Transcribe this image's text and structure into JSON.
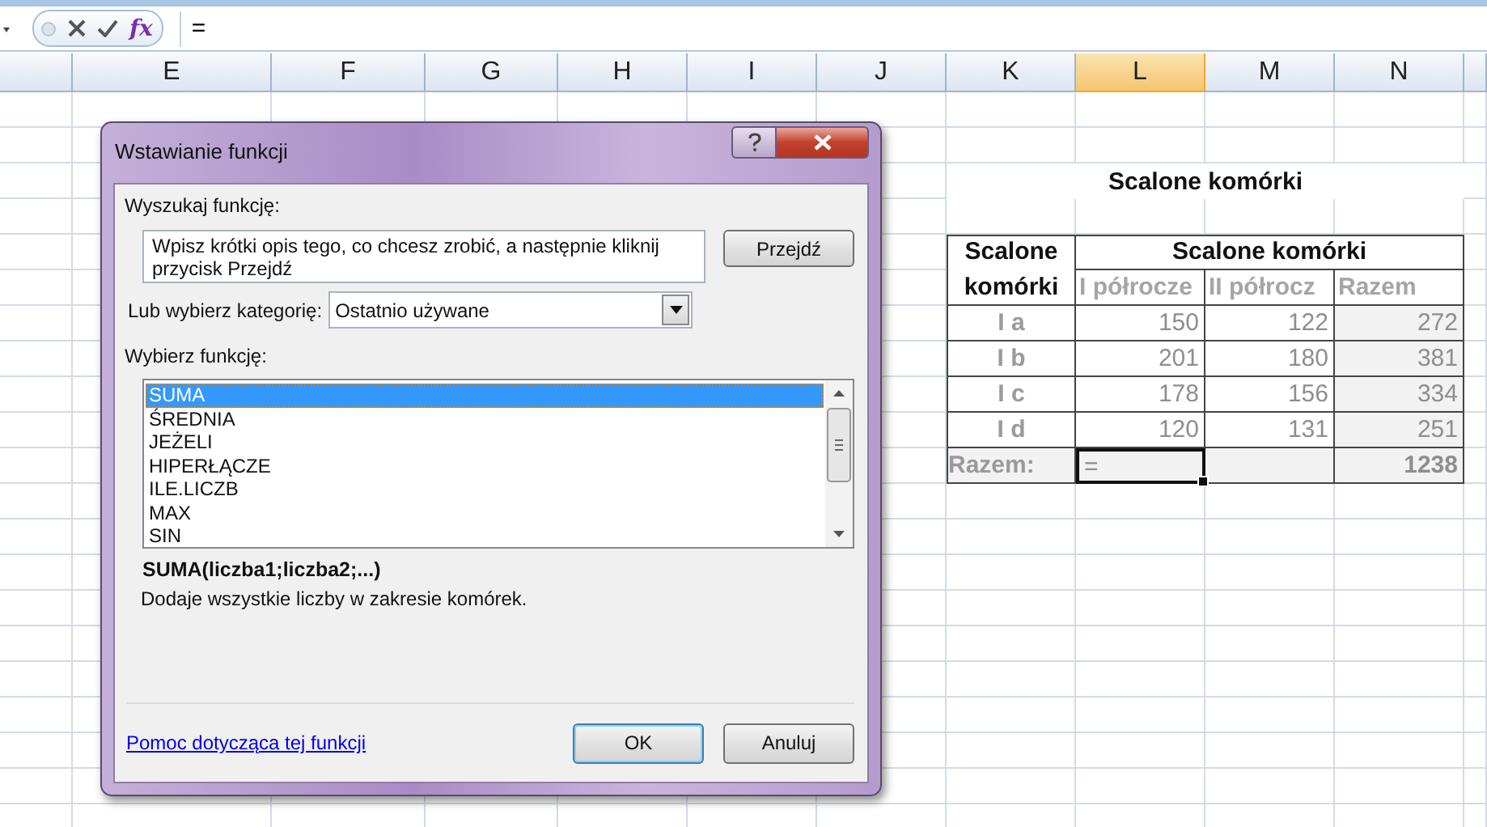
{
  "formula_bar": {
    "function_button": "fx",
    "formula": "="
  },
  "columns": [
    {
      "label": "E",
      "selected": false
    },
    {
      "label": "F",
      "selected": false
    },
    {
      "label": "G",
      "selected": false
    },
    {
      "label": "H",
      "selected": false
    },
    {
      "label": "I",
      "selected": false
    },
    {
      "label": "J",
      "selected": false
    },
    {
      "label": "K",
      "selected": false
    },
    {
      "label": "L",
      "selected": true
    },
    {
      "label": "M",
      "selected": false
    },
    {
      "label": "N",
      "selected": false
    }
  ],
  "sheet": {
    "title": "Scalone komórki",
    "table": {
      "corner_header": "Scalone komórki",
      "group_header": "Scalone komórki",
      "subheaders": [
        "I półrocze",
        "II półrocz",
        "Razem"
      ],
      "rows": [
        {
          "label": "I a",
          "values": [
            "150",
            "122",
            "272"
          ]
        },
        {
          "label": "I b",
          "values": [
            "201",
            "180",
            "381"
          ]
        },
        {
          "label": "I c",
          "values": [
            "178",
            "156",
            "334"
          ]
        },
        {
          "label": "I d",
          "values": [
            "120",
            "131",
            "251"
          ]
        }
      ],
      "total_row": {
        "label": "Razem:",
        "cells": [
          {
            "text": "=",
            "selected": true
          },
          {
            "selected": false
          },
          {
            "text": "1238",
            "selected": false
          }
        ]
      }
    }
  },
  "dialog": {
    "title": "Wstawianie funkcji",
    "search_label": "Wyszukaj funkcję:",
    "search_value": "Wpisz krótki opis tego, co chcesz zrobić, a następnie kliknij przycisk Przejdź",
    "go_button": "Przejdź",
    "category_label": "Lub wybierz kategorię:",
    "category_value": "Ostatnio używane",
    "functions_label": "Wybierz funkcję:",
    "functions": [
      {
        "name": "SUMA",
        "selected": true
      },
      {
        "name": "ŚREDNIA",
        "selected": false
      },
      {
        "name": "JEŻELI",
        "selected": false
      },
      {
        "name": "HIPERŁĄCZE",
        "selected": false
      },
      {
        "name": "ILE.LICZB",
        "selected": false
      },
      {
        "name": "MAX",
        "selected": false
      },
      {
        "name": "SIN",
        "selected": false
      }
    ],
    "signature": "SUMA(liczba1;liczba2;...)",
    "description": "Dodaje wszystkie liczby w zakresie komórek.",
    "help_link": "Pomoc dotycząca tej funkcji",
    "buttons": [
      {
        "label": "OK",
        "default": true
      },
      {
        "label": "Anuluj",
        "default": false
      }
    ]
  }
}
